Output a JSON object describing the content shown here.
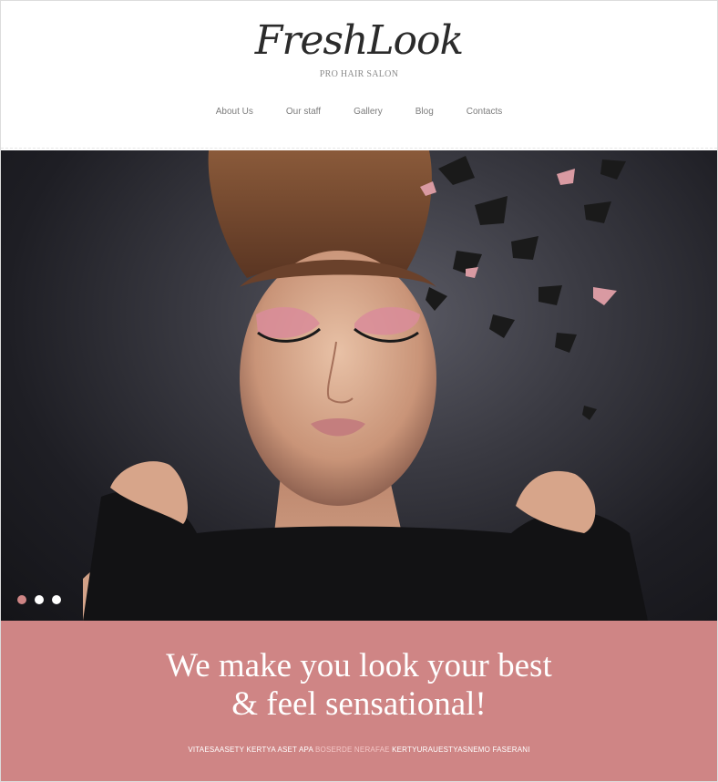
{
  "header": {
    "logo": "FreshLook",
    "tagline": "PRO HAIR SALON"
  },
  "nav": {
    "items": [
      "About Us",
      "Our staff",
      "Gallery",
      "Blog",
      "Contacts"
    ]
  },
  "hero": {
    "image": "woman-with-updo-and-pink-butterfly-makeup",
    "slides_total": 3,
    "active_slide": 1
  },
  "banner": {
    "line1": "We make you look your best",
    "line2": "& feel sensational!",
    "sub_part1": "VITAESAASETY KERTYA ASET APA",
    "sub_highlight": "BOSERDE NERAFAE",
    "sub_part2": "KERTYURAUESTYASNEMO FASERANI"
  },
  "colors": {
    "accent": "#cf8585",
    "highlight": "#f4c6c6",
    "text_dark": "#2b2b2b",
    "nav_text": "#7d7d7d"
  }
}
